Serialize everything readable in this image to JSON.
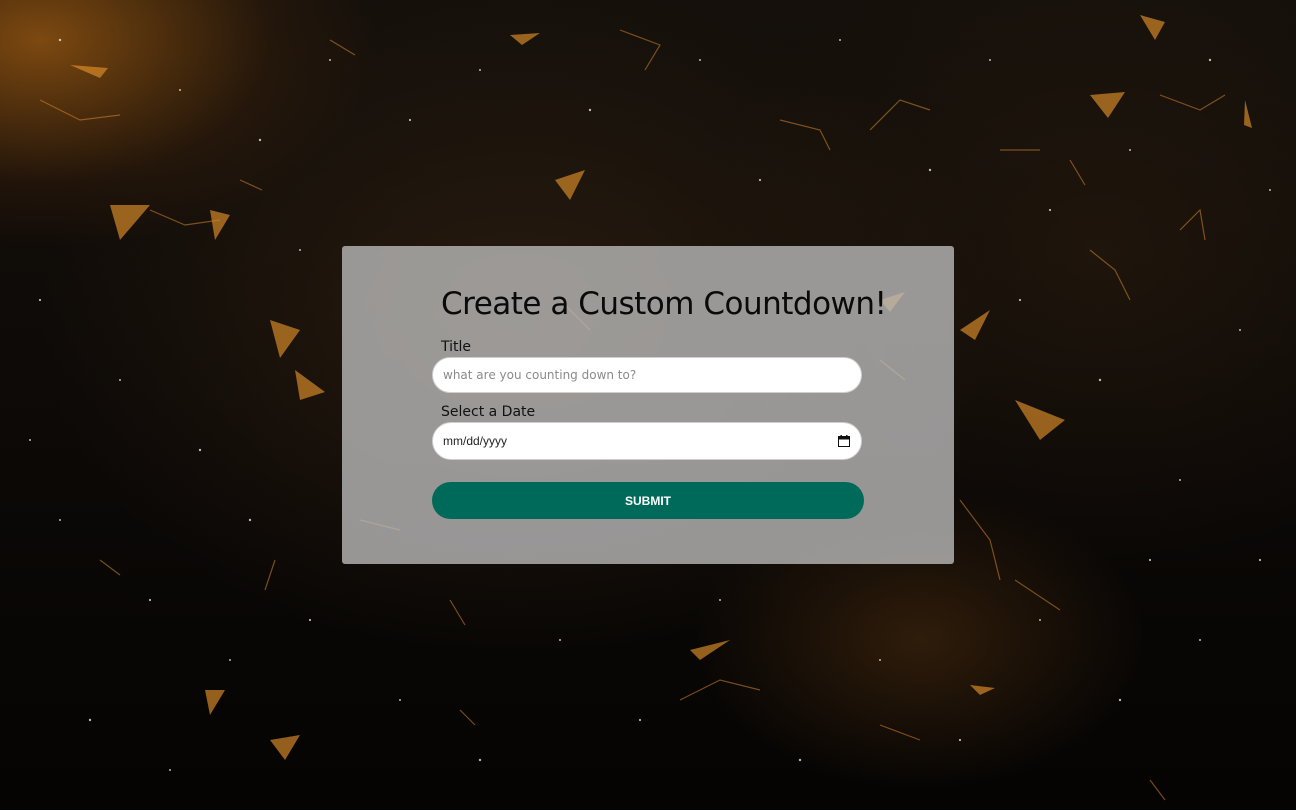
{
  "form": {
    "title": "Create a Custom Countdown!",
    "title_label": "Title",
    "title_placeholder": "what are you counting down to?",
    "title_value": "",
    "date_label": "Select a Date",
    "date_placeholder": "mm/dd/yyyy",
    "submit_label": "SUBMIT"
  },
  "icons": {
    "date_picker": "calendar-icon"
  },
  "colors": {
    "submit_button": "#006a5a",
    "card_background": "#bebebe",
    "background_glow": "#d2781a"
  }
}
